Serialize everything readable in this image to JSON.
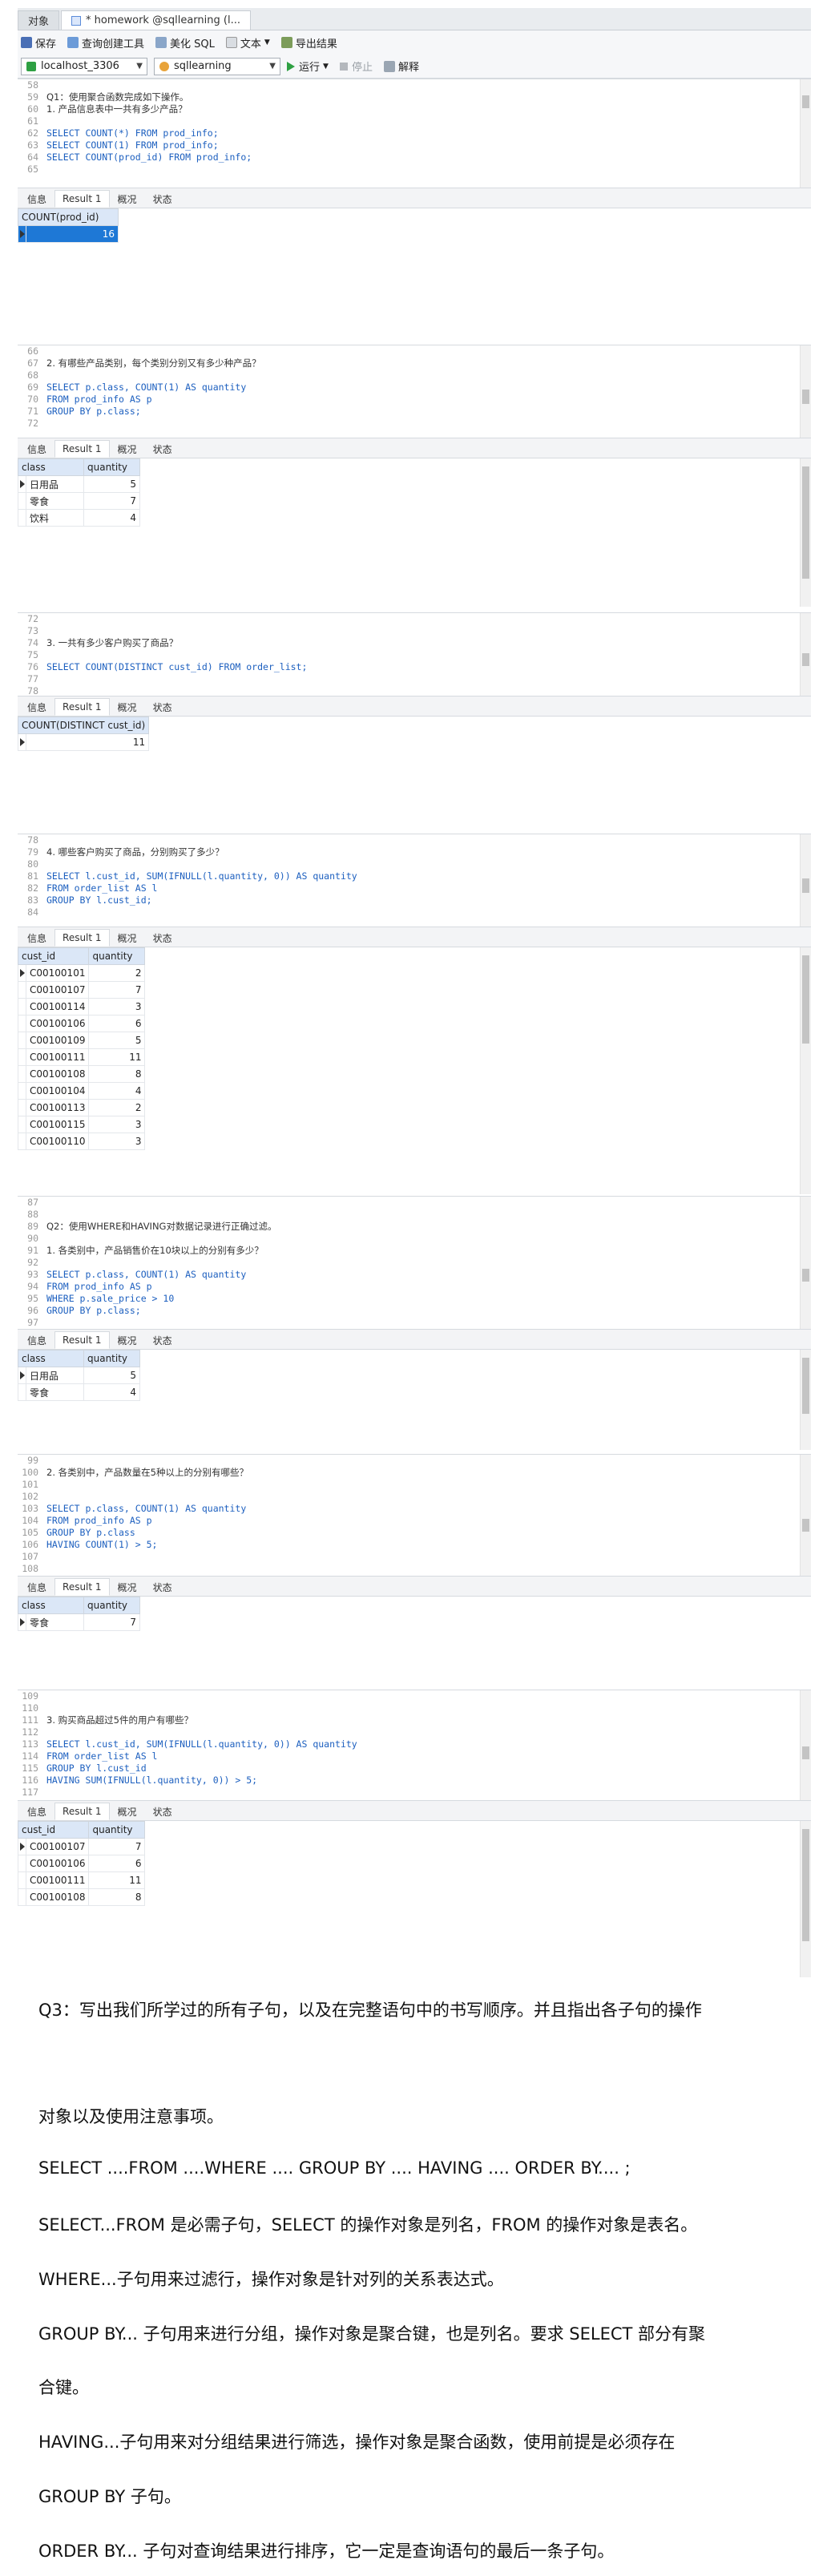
{
  "window": {
    "tabs": [
      {
        "label": "对象"
      },
      {
        "label": "* homework @sqllearning (l..."
      }
    ],
    "toolbar": {
      "save": "保存",
      "query_builder": "查询创建工具",
      "beautify": "美化 SQL",
      "text": "文本",
      "export": "导出结果"
    },
    "toolbar2": {
      "connection": "localhost_3306",
      "database": "sqllearning",
      "run": "运行",
      "stop": "停止",
      "explain": "解释"
    }
  },
  "result_tabs": [
    "信息",
    "Result 1",
    "概况",
    "状态"
  ],
  "blocks": [
    {
      "lines": [
        {
          "n": "58",
          "t": ""
        },
        {
          "n": "59",
          "t": "Q1：使用聚合函数完成如下操作。",
          "c": true
        },
        {
          "n": "60",
          "t": "1. 产品信息表中一共有多少产品？",
          "c": true
        },
        {
          "n": "61",
          "t": ""
        },
        {
          "n": "62",
          "t": "SELECT COUNT(*) FROM prod_info;"
        },
        {
          "n": "63",
          "t": "SELECT COUNT(1) FROM prod_info;"
        },
        {
          "n": "64",
          "t": "SELECT COUNT(prod_id) FROM prod_info;"
        },
        {
          "n": "65",
          "t": ""
        }
      ],
      "columns": [
        "COUNT(prod_id)"
      ],
      "rows": [
        [
          "16"
        ]
      ]
    },
    {
      "lines": [
        {
          "n": "66",
          "t": ""
        },
        {
          "n": "67",
          "t": "2. 有哪些产品类别，每个类别分别又有多少种产品？",
          "c": true
        },
        {
          "n": "68",
          "t": ""
        },
        {
          "n": "69",
          "t": "SELECT p.class, COUNT(1) AS quantity"
        },
        {
          "n": "70",
          "t": "FROM prod_info AS p"
        },
        {
          "n": "71",
          "t": "GROUP BY p.class;"
        },
        {
          "n": "72",
          "t": ""
        }
      ],
      "columns": [
        "class",
        "quantity"
      ],
      "rows": [
        [
          "日用品",
          "5"
        ],
        [
          "零食",
          "7"
        ],
        [
          "饮料",
          "4"
        ]
      ]
    },
    {
      "lines": [
        {
          "n": "72",
          "t": ""
        },
        {
          "n": "73",
          "t": ""
        },
        {
          "n": "74",
          "t": "3. 一共有多少客户购买了商品？",
          "c": true
        },
        {
          "n": "75",
          "t": ""
        },
        {
          "n": "76",
          "t": "SELECT COUNT(DISTINCT cust_id) FROM order_list;"
        },
        {
          "n": "77",
          "t": ""
        },
        {
          "n": "78",
          "t": ""
        }
      ],
      "columns": [
        "COUNT(DISTINCT cust_id)"
      ],
      "rows": [
        [
          "11"
        ]
      ]
    },
    {
      "lines": [
        {
          "n": "78",
          "t": ""
        },
        {
          "n": "79",
          "t": "4. 哪些客户购买了商品，分别购买了多少？",
          "c": true
        },
        {
          "n": "80",
          "t": ""
        },
        {
          "n": "81",
          "t": "SELECT l.cust_id, SUM(IFNULL(l.quantity, 0)) AS quantity"
        },
        {
          "n": "82",
          "t": "FROM order_list AS l"
        },
        {
          "n": "83",
          "t": "GROUP BY l.cust_id;"
        },
        {
          "n": "84",
          "t": ""
        }
      ],
      "columns": [
        "cust_id",
        "quantity"
      ],
      "rows": [
        [
          "C00100101",
          "2"
        ],
        [
          "C00100107",
          "7"
        ],
        [
          "C00100114",
          "3"
        ],
        [
          "C00100106",
          "6"
        ],
        [
          "C00100109",
          "5"
        ],
        [
          "C00100111",
          "11"
        ],
        [
          "C00100108",
          "8"
        ],
        [
          "C00100104",
          "4"
        ],
        [
          "C00100113",
          "2"
        ],
        [
          "C00100115",
          "3"
        ],
        [
          "C00100110",
          "3"
        ]
      ]
    },
    {
      "lines": [
        {
          "n": "87",
          "t": ""
        },
        {
          "n": "88",
          "t": ""
        },
        {
          "n": "89",
          "t": "Q2：使用WHERE和HAVING对数据记录进行正确过滤。",
          "c": true
        },
        {
          "n": "90",
          "t": ""
        },
        {
          "n": "91",
          "t": "1. 各类别中，产品销售价在10块以上的分别有多少？",
          "c": true
        },
        {
          "n": "92",
          "t": ""
        },
        {
          "n": "93",
          "t": "SELECT p.class, COUNT(1) AS quantity"
        },
        {
          "n": "94",
          "t": "FROM prod_info AS p"
        },
        {
          "n": "95",
          "t": "WHERE p.sale_price > 10"
        },
        {
          "n": "96",
          "t": "GROUP BY p.class;"
        },
        {
          "n": "97",
          "t": ""
        }
      ],
      "columns": [
        "class",
        "quantity"
      ],
      "rows": [
        [
          "日用品",
          "5"
        ],
        [
          "零食",
          "4"
        ]
      ]
    },
    {
      "lines": [
        {
          "n": "99",
          "t": ""
        },
        {
          "n": "100",
          "t": "2. 各类别中，产品数量在5种以上的分别有哪些？",
          "c": true
        },
        {
          "n": "101",
          "t": ""
        },
        {
          "n": "102",
          "t": ""
        },
        {
          "n": "103",
          "t": "SELECT p.class, COUNT(1) AS quantity"
        },
        {
          "n": "104",
          "t": "FROM prod_info AS p"
        },
        {
          "n": "105",
          "t": "GROUP BY p.class"
        },
        {
          "n": "106",
          "t": "HAVING COUNT(1) > 5;"
        },
        {
          "n": "107",
          "t": ""
        },
        {
          "n": "108",
          "t": ""
        }
      ],
      "columns": [
        "class",
        "quantity"
      ],
      "rows": [
        [
          "零食",
          "7"
        ]
      ]
    },
    {
      "lines": [
        {
          "n": "109",
          "t": ""
        },
        {
          "n": "110",
          "t": ""
        },
        {
          "n": "111",
          "t": "3. 购买商品超过5件的用户有哪些？",
          "c": true
        },
        {
          "n": "112",
          "t": ""
        },
        {
          "n": "113",
          "t": "SELECT l.cust_id, SUM(IFNULL(l.quantity, 0)) AS quantity"
        },
        {
          "n": "114",
          "t": "FROM order_list AS l"
        },
        {
          "n": "115",
          "t": "GROUP BY l.cust_id"
        },
        {
          "n": "116",
          "t": "HAVING SUM(IFNULL(l.quantity, 0)) > 5;"
        },
        {
          "n": "117",
          "t": ""
        }
      ],
      "columns": [
        "cust_id",
        "quantity"
      ],
      "rows": [
        [
          "C00100107",
          "7"
        ],
        [
          "C00100106",
          "6"
        ],
        [
          "C00100111",
          "11"
        ],
        [
          "C00100108",
          "8"
        ]
      ]
    }
  ],
  "prose": {
    "q3_line1": "Q3：写出我们所学过的所有子句，以及在完整语句中的书写顺序。并且指出各子句的操作",
    "q3_line2": "对象以及使用注意事项。",
    "p1": "SELECT ....FROM ....WHERE .... GROUP BY .... HAVING .... ORDER BY.... ;",
    "p2": "SELECT...FROM 是必需子句，SELECT  的操作对象是列名，FROM 的操作对象是表名。",
    "p3": "WHERE...子句用来过滤行，操作对象是针对列的关系表达式。",
    "p4a": "GROUP  BY...  子句用来进行分组，操作对象是聚合键，也是列名。要求 SELECT 部分有聚",
    "p4b": "合键。",
    "p5a": "HAVING...子句用来对分组结果进行筛选，操作对象是聚合函数，使用前提是必须存在",
    "p5b": "GROUP BY 子句。",
    "p6": "ORDER BY...  子句对查询结果进行排序，它一定是查询语句的最后一条子句。"
  }
}
